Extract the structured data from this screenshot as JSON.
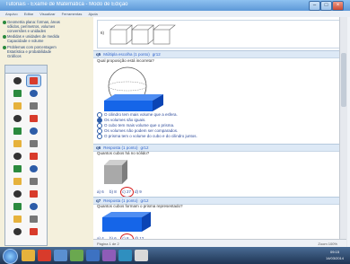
{
  "window": {
    "title": "Tutoriais - Exame de Matemática - Modo de Edição"
  },
  "menu": [
    "Arquivo",
    "Editar",
    "Visualizar",
    "Ferramentas",
    "Ajuda"
  ],
  "left_pane": {
    "items": [
      "Geometria plana: formas, áreas",
      "sólidos, perímetros, volumes",
      "conversões e unidades",
      "Medidas e unidades de medida",
      "Capacidade e volume",
      "Problemas com porcentagem",
      "Estatística e probabilidade",
      "Gráficos"
    ]
  },
  "palette": {
    "tools": [
      "pointer",
      "lasso",
      "brush",
      "pencil",
      "marker",
      "eraser",
      "text",
      "line",
      "arrow",
      "square",
      "circle",
      "triangle",
      "fill",
      "color",
      "image",
      "shape",
      "table",
      "cut",
      "copy",
      "paste",
      "undo",
      "redo",
      "zoom",
      "screen",
      "highlight",
      "laser"
    ]
  },
  "questions": [
    {
      "num": "6)",
      "bar": ""
    },
    {
      "num": "q5",
      "tag": "Múltipla escolha (1 ponto)",
      "grade": "gr12",
      "text": "Qual proposição está incorreta?",
      "options": [
        "O cilindro tem mais volume que a esfera.",
        "Os volumes são iguais.",
        "O cubo tem mais volume que o prisma.",
        "Os volumes não podem ser comparados.",
        "O prisma tem o volume do cubo e do cilindro juntos."
      ],
      "selected": 1
    },
    {
      "num": "q6",
      "tag": "Resposta (1 ponto)",
      "grade": "gr12",
      "text": "Quantos cubos há no sólido?",
      "options": [
        "a) 6",
        "b) 8",
        "c) 27",
        "d) 9"
      ],
      "circled": 2
    },
    {
      "num": "q7",
      "tag": "Resposta (1 ponto)",
      "grade": "gr12",
      "text": "Quantos cubos formam o prisma representado?",
      "options": [
        "a) 4",
        "b) 6",
        "c) 8",
        "d) 12"
      ],
      "circled": 2
    }
  ],
  "status": {
    "left": "Página 1 de 2",
    "right": "Zoom 100%"
  },
  "clock": {
    "time": "09:15",
    "date": "14/03/2014"
  },
  "colors": {
    "accent": "#2c5ca8",
    "solid": "#1565e8",
    "circle": "#d62020"
  }
}
